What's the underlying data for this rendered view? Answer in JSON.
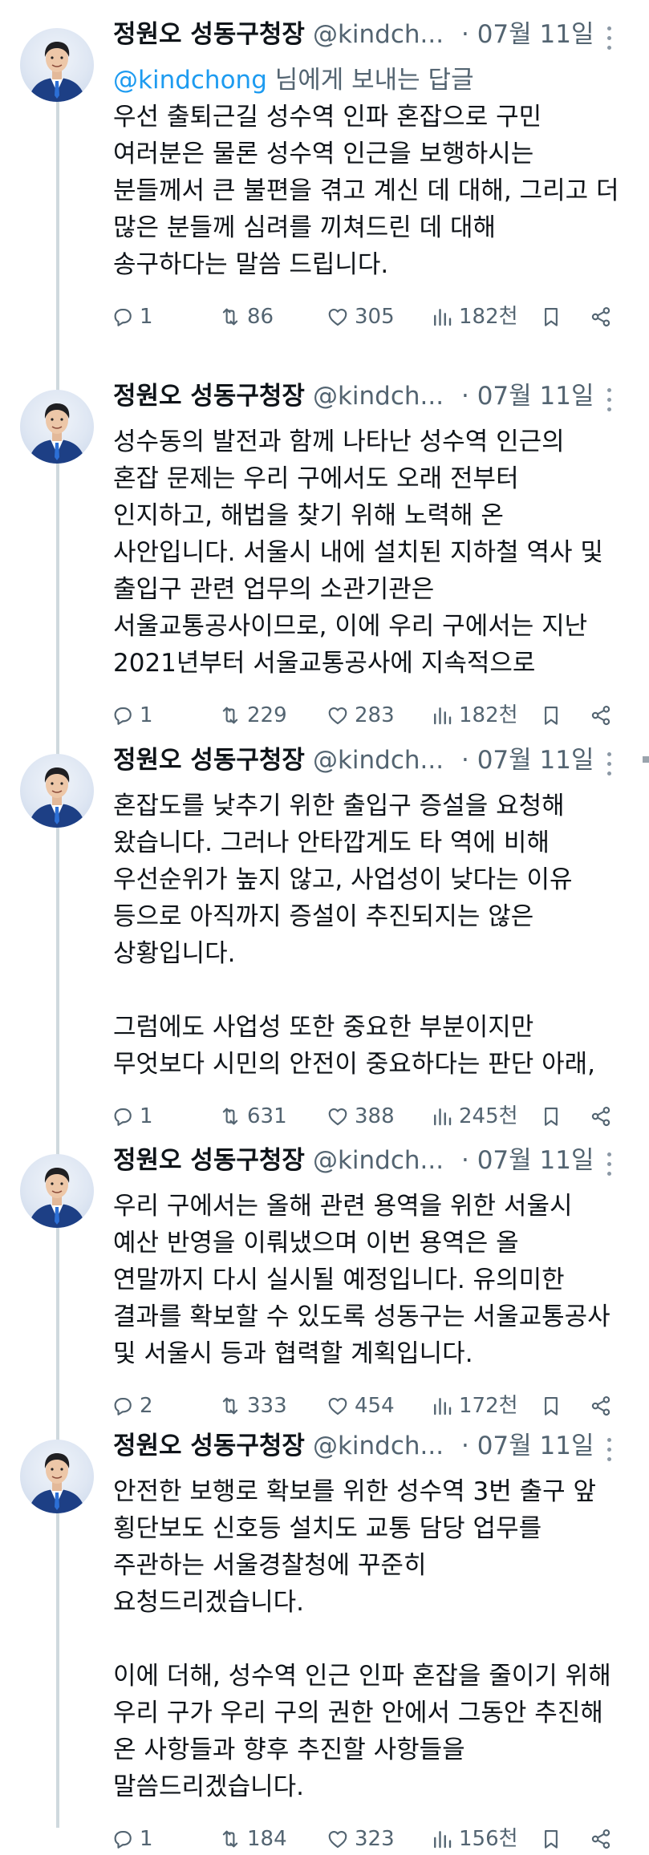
{
  "author": {
    "name": "정원오 성동구청장",
    "handle": "@kindch...",
    "date": "· 07월 11일"
  },
  "tweets": [
    {
      "reply_to": {
        "mention": "@kindchong",
        "suffix": " 님에게 보내는 답글"
      },
      "lines": [
        "우선 출퇴근길 성수역 인파 혼잡으로 구민",
        "여러분은 물론 성수역 인근을 보행하시는",
        "분들께서 큰 불편을 겪고 계신 데 대해, 그리고 더",
        "많은 분들께 심려를 끼쳐드린 데 대해",
        "송구하다는 말씀 드립니다."
      ],
      "stats": {
        "replies": "1",
        "retweets": "86",
        "likes": "305",
        "views": "182천"
      }
    },
    {
      "lines": [
        "성수동의 발전과 함께 나타난 성수역 인근의",
        "혼잡 문제는 우리 구에서도 오래 전부터",
        "인지하고, 해법을 찾기 위해 노력해 온",
        "사안입니다. 서울시 내에 설치된 지하철 역사 및",
        "출입구 관련 업무의 소관기관은",
        "서울교통공사이므로, 이에 우리 구에서는 지난",
        "2021년부터 서울교통공사에 지속적으로"
      ],
      "stats": {
        "replies": "1",
        "retweets": "229",
        "likes": "283",
        "views": "182천"
      }
    },
    {
      "lines": [
        "혼잡도를 낮추기 위한 출입구 증설을 요청해",
        "왔습니다. 그러나 안타깝게도 타 역에 비해",
        "우선순위가 높지 않고, 사업성이 낮다는 이유",
        "등으로 아직까지 증설이 추진되지는 않은",
        "상황입니다.",
        "",
        "그럼에도 사업성 또한 중요한 부분이지만",
        "무엇보다 시민의 안전이 중요하다는 판단 아래,"
      ],
      "stats": {
        "replies": "1",
        "retweets": "631",
        "likes": "388",
        "views": "245천"
      }
    },
    {
      "lines": [
        "우리 구에서는 올해 관련 용역을 위한 서울시",
        "예산 반영을 이뤄냈으며 이번 용역은 올",
        "연말까지 다시 실시될 예정입니다. 유의미한",
        "결과를 확보할 수 있도록 성동구는 서울교통공사",
        "및 서울시 등과 협력할 계획입니다."
      ],
      "stats": {
        "replies": "2",
        "retweets": "333",
        "likes": "454",
        "views": "172천"
      }
    },
    {
      "lines": [
        "안전한 보행로 확보를 위한 성수역 3번 출구 앞",
        "횡단보도 신호등 설치도 교통 담당 업무를",
        "주관하는 서울경찰청에 꾸준히",
        "요청드리겠습니다.",
        "",
        "이에 더해, 성수역 인근 인파 혼잡을 줄이기 위해",
        "우리 구가 우리 구의 권한 안에서 그동안 추진해",
        "온 사항들과 향후 추진할 사항들을",
        "말씀드리겠습니다."
      ],
      "stats": {
        "replies": "1",
        "retweets": "184",
        "likes": "323",
        "views": "156천"
      }
    }
  ],
  "icons": {
    "reply": "reply-icon",
    "retweet": "retweet-icon",
    "like": "heart-icon",
    "views": "views-icon",
    "bookmark": "bookmark-icon",
    "share": "share-icon",
    "more": "more-icon"
  },
  "colors": {
    "text": "#0f1419",
    "secondary": "#536471",
    "link": "#1d9bf0",
    "thread_line": "#cfd9de"
  }
}
